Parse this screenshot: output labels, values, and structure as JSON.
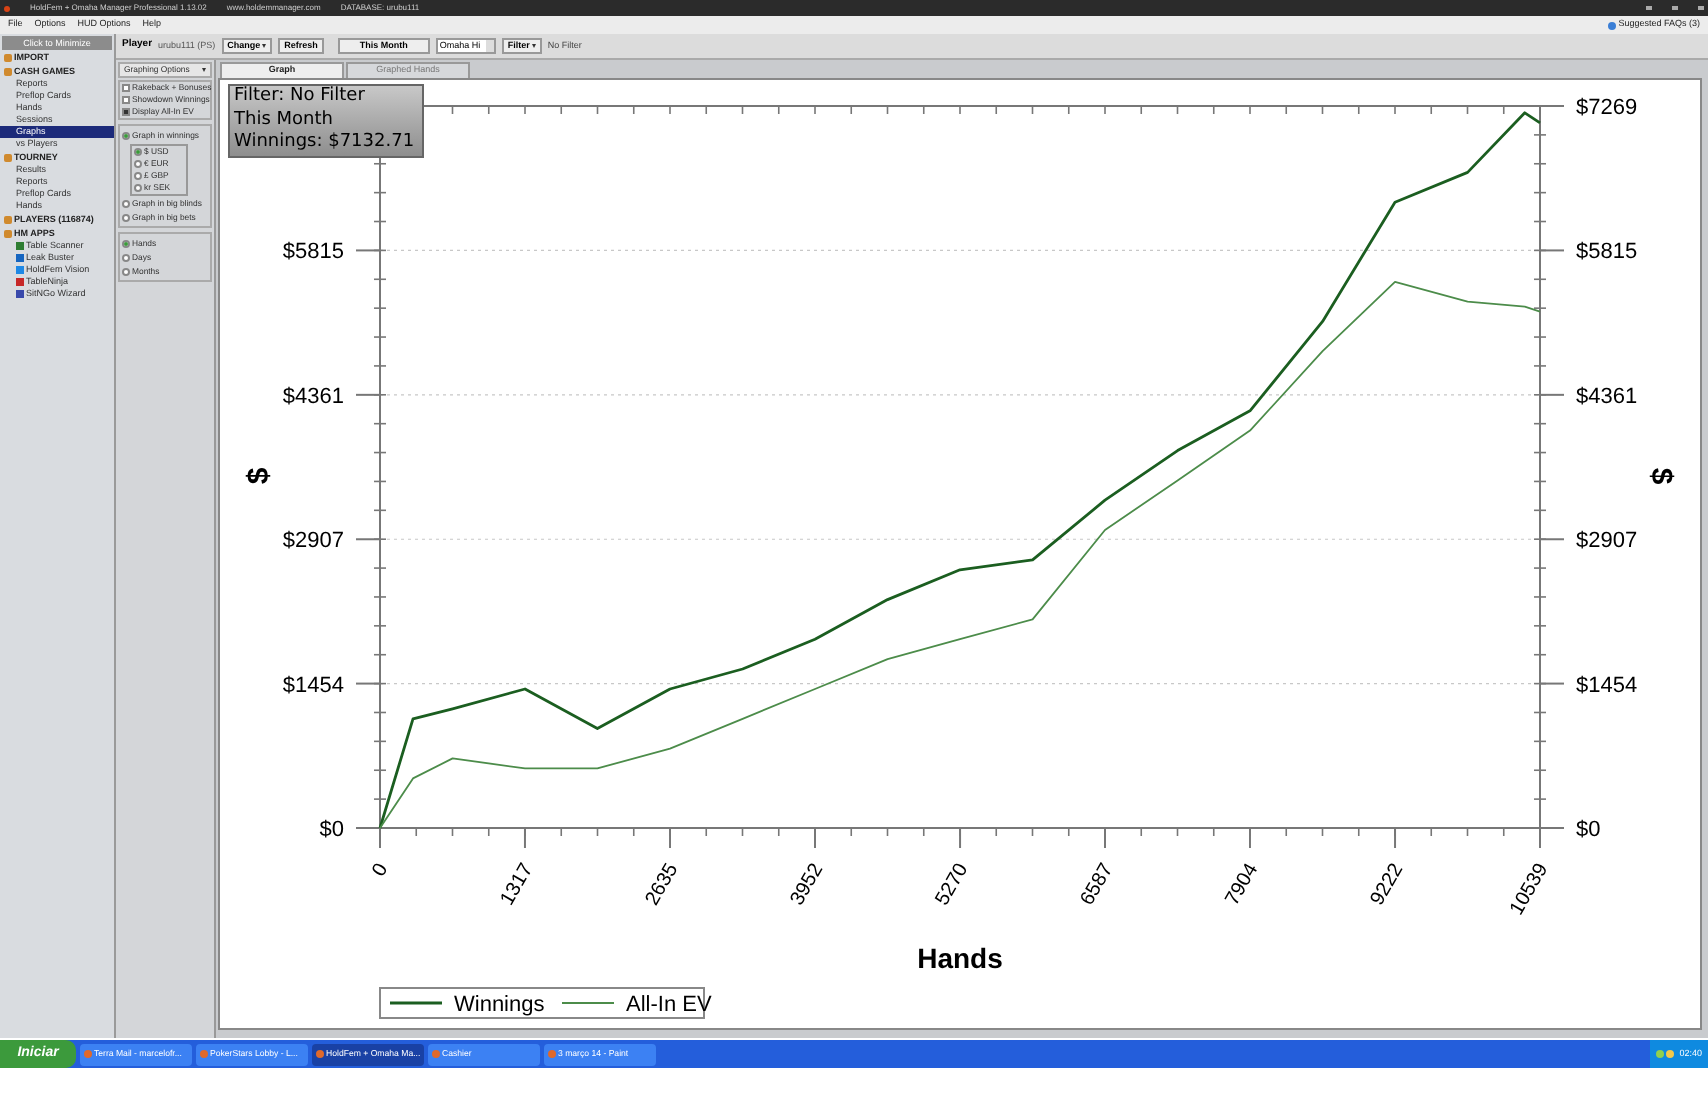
{
  "window": {
    "title": "HoldFem + Omaha Manager Professional 1.13.02",
    "website": "www.holdemmanager.com",
    "database": "DATABASE: urubu111"
  },
  "menu": [
    "File",
    "Options",
    "HUD Options",
    "Help"
  ],
  "faq": "Suggested FAQs (3)",
  "sidebar": {
    "minimize": "Click to Minimize",
    "sections": [
      {
        "label": "IMPORT"
      },
      {
        "label": "CASH GAMES",
        "children": [
          {
            "label": "Reports",
            "selected": false
          },
          {
            "label": "Preflop Cards",
            "selected": false
          },
          {
            "label": "Hands",
            "selected": false
          },
          {
            "label": "Sessions",
            "selected": false
          },
          {
            "label": "Graphs",
            "selected": true
          },
          {
            "label": "vs Players",
            "selected": false
          }
        ]
      },
      {
        "label": "TOURNEY",
        "children": [
          {
            "label": "Results",
            "selected": false
          },
          {
            "label": "Reports",
            "selected": false
          },
          {
            "label": "Preflop Cards",
            "selected": false
          },
          {
            "label": "Hands",
            "selected": false
          }
        ]
      },
      {
        "label": "PLAYERS (116874)"
      },
      {
        "label": "HM APPS",
        "children": [
          {
            "label": "Table Scanner",
            "selected": false,
            "color": "#2e7d32"
          },
          {
            "label": "Leak Buster",
            "selected": false,
            "color": "#1565c0"
          },
          {
            "label": "HoldFem Vision",
            "selected": false,
            "color": "#1e88e5"
          },
          {
            "label": "TableNinja",
            "selected": false,
            "color": "#c62828"
          },
          {
            "label": "SitNGo Wizard",
            "selected": false,
            "color": "#3949ab"
          }
        ]
      }
    ]
  },
  "toolbar": {
    "player_label": "Player",
    "player": "urubu111 (PS)",
    "buttons": [
      {
        "label": "Change",
        "dropdown": true
      },
      {
        "label": "Refresh",
        "dropdown": false
      }
    ],
    "period": "This Month",
    "game": "Omaha Hi",
    "filter": "Filter",
    "filter_value": "No Filter"
  },
  "options": {
    "title": "Graphing Options",
    "checkboxes": [
      {
        "label": "Rakeback + Bonuses",
        "checked": false
      },
      {
        "label": "Showdown Winnings",
        "checked": false
      },
      {
        "label": "Display All-In EV",
        "checked": true
      }
    ],
    "mode": [
      {
        "label": "Graph in winnings",
        "selected": true,
        "currencies": [
          {
            "label": "$ USD",
            "selected": true
          },
          {
            "label": "€ EUR",
            "selected": false
          },
          {
            "label": "£ GBP",
            "selected": false
          },
          {
            "label": "kr SEK",
            "selected": false
          }
        ]
      },
      {
        "label": "Graph in big blinds",
        "selected": false
      },
      {
        "label": "Graph in big bets",
        "selected": false
      }
    ],
    "axis": [
      {
        "label": "Hands",
        "selected": true
      },
      {
        "label": "Days",
        "selected": false
      },
      {
        "label": "Months",
        "selected": false
      }
    ]
  },
  "tabs": [
    {
      "label": "Graph",
      "selected": true
    },
    {
      "label": "Graphed Hands",
      "selected": false
    }
  ],
  "info_box": [
    "Filter: No Filter",
    "This Month",
    "Winnings: $7132.71"
  ],
  "chart_data": {
    "type": "line",
    "xlabel": "Hands",
    "ylabel": "$",
    "x": [
      0,
      300,
      659,
      1317,
      1976,
      2635,
      3294,
      3952,
      4611,
      5270,
      5929,
      6587,
      7246,
      7904,
      8563,
      9222,
      9881,
      10400,
      10539
    ],
    "series": [
      {
        "name": "Winnings",
        "color": "#1b5e20",
        "values": [
          0,
          1100,
          1200,
          1400,
          1000,
          1400,
          1600,
          1900,
          2300,
          2600,
          2700,
          3300,
          3800,
          4200,
          5100,
          6300,
          6600,
          7200,
          7100
        ]
      },
      {
        "name": "All-In EV",
        "color": "#4c8c4a",
        "values": [
          0,
          500,
          700,
          600,
          600,
          800,
          1100,
          1400,
          1700,
          1900,
          2100,
          3000,
          3500,
          4000,
          4800,
          5500,
          5300,
          5250,
          5200
        ]
      }
    ],
    "grid": true,
    "legend": "lower left",
    "xlim": [
      0,
      10539
    ],
    "ylim": [
      0,
      7269
    ],
    "xticks": [
      0,
      1317,
      2635,
      3952,
      5270,
      6587,
      7904,
      9222,
      10539
    ],
    "yticks": [
      {
        "value": 0,
        "label": "$0"
      },
      {
        "value": 1454,
        "label": "$1454"
      },
      {
        "value": 2907,
        "label": "$2907"
      },
      {
        "value": 4361,
        "label": "$4361"
      },
      {
        "value": 5815,
        "label": "$5815"
      },
      {
        "value": 7269,
        "label": "$7269"
      }
    ]
  },
  "taskbar": {
    "start": "Iniciar",
    "tasks": [
      {
        "label": "Terra Mail - marcelofr...",
        "selected": false
      },
      {
        "label": "PokerStars Lobby - L...",
        "selected": false
      },
      {
        "label": "HoldFem + Omaha Ma...",
        "selected": true
      },
      {
        "label": "Cashier",
        "selected": false
      },
      {
        "label": "3 março 14 - Paint",
        "selected": false
      }
    ],
    "clock": "02:40"
  }
}
